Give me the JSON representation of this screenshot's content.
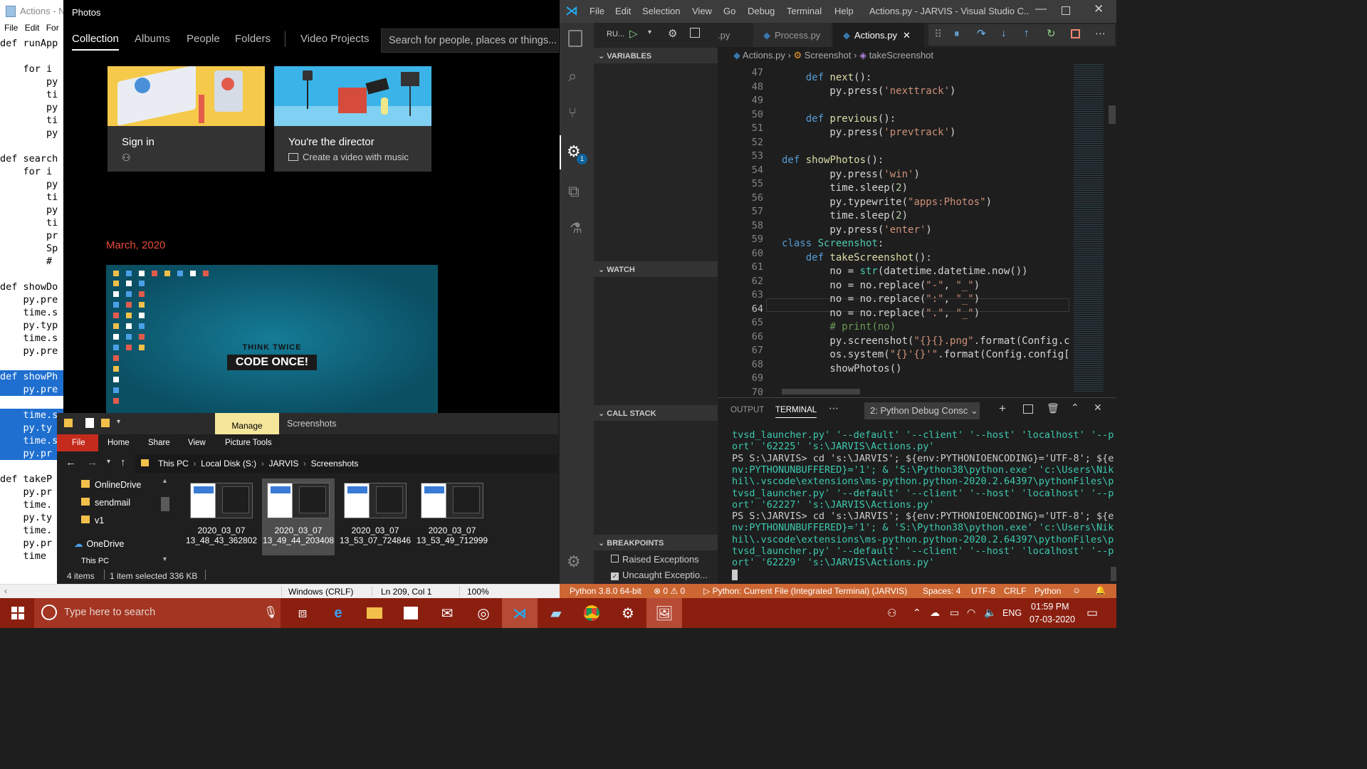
{
  "notepad": {
    "title": "Actions - N",
    "menu": [
      "File",
      "Edit",
      "For"
    ],
    "lines": [
      {
        "t": "def runApp",
        "sel": false
      },
      {
        "t": "",
        "sel": false
      },
      {
        "t": "    for i",
        "sel": false
      },
      {
        "t": "        py",
        "sel": false
      },
      {
        "t": "        ti",
        "sel": false
      },
      {
        "t": "        py",
        "sel": false
      },
      {
        "t": "        ti",
        "sel": false
      },
      {
        "t": "        py",
        "sel": false
      },
      {
        "t": "",
        "sel": false
      },
      {
        "t": "def search",
        "sel": false
      },
      {
        "t": "    for i",
        "sel": false
      },
      {
        "t": "        py",
        "sel": false
      },
      {
        "t": "        ti",
        "sel": false
      },
      {
        "t": "        py",
        "sel": false
      },
      {
        "t": "        ti",
        "sel": false
      },
      {
        "t": "        pr",
        "sel": false
      },
      {
        "t": "        Sp",
        "sel": false
      },
      {
        "t": "        #",
        "sel": false
      },
      {
        "t": "",
        "sel": false
      },
      {
        "t": "def showDo",
        "sel": false
      },
      {
        "t": "    py.pre",
        "sel": false
      },
      {
        "t": "    time.s",
        "sel": false
      },
      {
        "t": "    py.typ",
        "sel": false
      },
      {
        "t": "    time.s",
        "sel": false
      },
      {
        "t": "    py.pre",
        "sel": false
      },
      {
        "t": "",
        "sel": false
      },
      {
        "t": "def showPh",
        "sel": true
      },
      {
        "t": "    py.pre",
        "sel": true
      },
      {
        "t": "",
        "sel": false
      },
      {
        "t": "    time.s",
        "sel": true
      },
      {
        "t": "    py.ty",
        "sel": true
      },
      {
        "t": "    time.s",
        "sel": true
      },
      {
        "t": "    py.pr",
        "sel": true
      },
      {
        "t": "",
        "sel": false
      },
      {
        "t": "def takeP",
        "sel": false
      },
      {
        "t": "    py.pr",
        "sel": false
      },
      {
        "t": "    time.",
        "sel": false
      },
      {
        "t": "    py.ty",
        "sel": false
      },
      {
        "t": "    time.",
        "sel": false
      },
      {
        "t": "    py.pr",
        "sel": false
      },
      {
        "t": "    time",
        "sel": false
      }
    ],
    "status": {
      "eol": "Windows (CRLF)",
      "pos": "Ln 209, Col 1",
      "zoom": "100%"
    }
  },
  "photos": {
    "title": "Photos",
    "tabs": [
      "Collection",
      "Albums",
      "People",
      "Folders",
      "Video Projects"
    ],
    "search_placeholder": "Search for people, places or things...",
    "card1": {
      "title": "Sign in"
    },
    "card2": {
      "title": "You're the director",
      "sub": "Create a video with music"
    },
    "date": "March, 2020",
    "thumb": {
      "line1": "THINK TWICE",
      "line2": "CODE ONCE!"
    }
  },
  "explorer": {
    "manage": "Manage",
    "title": "Screenshots",
    "ribbon": [
      "File",
      "Home",
      "Share",
      "View",
      "Picture Tools"
    ],
    "path": [
      "This PC",
      "Local Disk (S:)",
      "JARVIS",
      "Screenshots"
    ],
    "nav": [
      "OnlineDrive",
      "sendmail",
      "v1",
      "OneDrive",
      "This PC"
    ],
    "files": [
      {
        "l1": "2020_03_07",
        "l2": "13_48_43_362802"
      },
      {
        "l1": "2020_03_07",
        "l2": "13_49_44_203408"
      },
      {
        "l1": "2020_03_07",
        "l2": "13_53_07_724846"
      },
      {
        "l1": "2020_03_07",
        "l2": "13_53_49_712999"
      }
    ],
    "status": {
      "items": "4 items",
      "selected": "1 item selected  336 KB"
    }
  },
  "vscode": {
    "menu": [
      "File",
      "Edit",
      "Selection",
      "View",
      "Go",
      "Debug",
      "Terminal",
      "Help"
    ],
    "title": "Actions.py - JARVIS - Visual Studio C...",
    "run_label": "RU...",
    "tabs": [
      ".py",
      "Process.py",
      "Actions.py"
    ],
    "breadcrumb": [
      "Actions.py",
      "Screenshot",
      "takeScreenshot"
    ],
    "sections": {
      "variables": "VARIABLES",
      "watch": "WATCH",
      "callstack": "CALL STACK",
      "breakpoints": "BREAKPOINTS"
    },
    "breakpoints": [
      {
        "label": "Raised Exceptions",
        "checked": false
      },
      {
        "label": "Uncaught Exceptio...",
        "checked": true
      }
    ],
    "line_numbers": [
      "47",
      "48",
      "49",
      "50",
      "51",
      "52",
      "53",
      "54",
      "55",
      "56",
      "57",
      "58",
      "59",
      "60",
      "61",
      "62",
      "63",
      "64",
      "65",
      "66",
      "67",
      "68",
      "69",
      "70"
    ],
    "panel_tabs": [
      "OUTPUT",
      "TERMINAL"
    ],
    "terminal_select": "2: Python Debug Consc",
    "terminal_lines": [
      "tvsd_launcher.py' '--default' '--client' '--host' 'localhost' '--p",
      "ort' '62225' 's:\\JARVIS\\Actions.py'",
      "PS S:\\JARVIS> cd 's:\\JARVIS'; ${env:PYTHONIOENCODING}='UTF-8'; ${e",
      "nv:PYTHONUNBUFFERED}='1'; & 'S:\\Python38\\python.exe' 'c:\\Users\\Nik",
      "hil\\.vscode\\extensions\\ms-python.python-2020.2.64397\\pythonFiles\\p",
      "tvsd_launcher.py' '--default' '--client' '--host' 'localhost' '--p",
      "ort' '62227' 's:\\JARVIS\\Actions.py'",
      "PS S:\\JARVIS> cd 's:\\JARVIS'; ${env:PYTHONIOENCODING}='UTF-8'; ${e",
      "nv:PYTHONUNBUFFERED}='1'; & 'S:\\Python38\\python.exe' 'c:\\Users\\Nik",
      "hil\\.vscode\\extensions\\ms-python.python-2020.2.64397\\pythonFiles\\p",
      "tvsd_launcher.py' '--default' '--client' '--host' 'localhost' '--p",
      "ort' '62229' 's:\\JARVIS\\Actions.py'"
    ],
    "status": {
      "python": "Python 3.8.0 64-bit",
      "problems": "⊗ 0 ⚠ 0",
      "run": "▷ Python: Current File (Integrated Terminal) (JARVIS)",
      "spaces": "Spaces: 4",
      "enc": "UTF-8",
      "eol": "CRLF",
      "lang": "Python"
    },
    "debug_badge": "1"
  },
  "taskbar": {
    "search_placeholder": "Type here to search",
    "lang": "ENG",
    "time": "01:59 PM",
    "date": "07-03-2020"
  },
  "colors": {
    "accent": "#007acc",
    "debug_status": "#cc6633",
    "taskbar": "#8a1f10",
    "photos_date": "#e74c3c"
  }
}
